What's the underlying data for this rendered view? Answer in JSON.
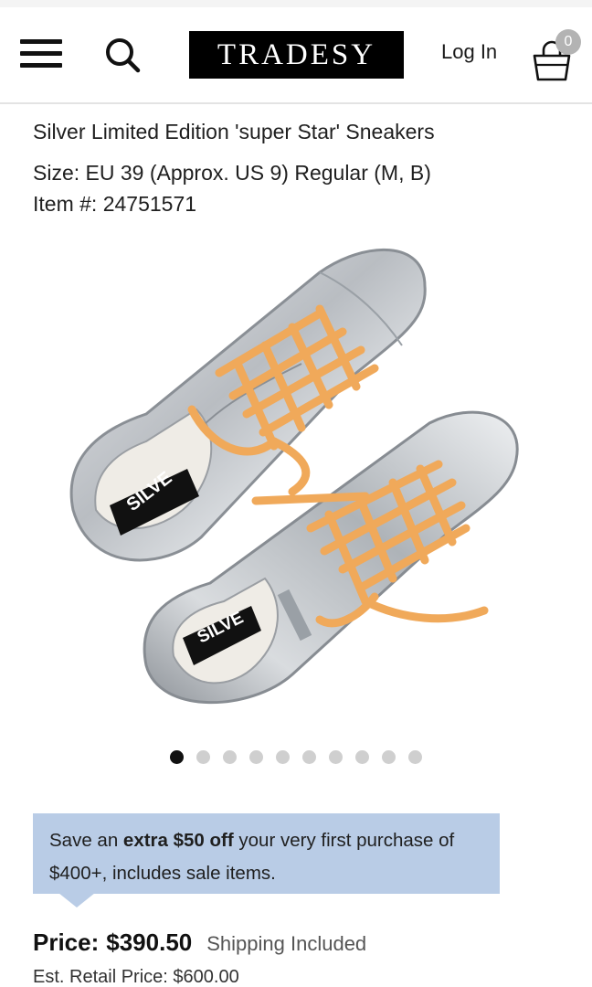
{
  "header": {
    "logo_text": "TRADESY",
    "login_label": "Log In",
    "cart_count": "0",
    "icons": {
      "menu": "hamburger-menu-icon",
      "search": "search-icon",
      "cart": "shopping-bag-icon"
    }
  },
  "product": {
    "title": "Silver Limited Edition 'super Star' Sneakers",
    "size_text": "Size: EU 39 (Approx. US 9) Regular (M, B)",
    "item_text": "Item #: 24751571",
    "label_text": "SILVE"
  },
  "gallery": {
    "total_images": 10,
    "active_index": 0
  },
  "promo": {
    "prefix": "Save an ",
    "highlight": "extra $50 off",
    "suffix": " your very first purchase of $400+, includes sale items."
  },
  "pricing": {
    "price_label": "Price:",
    "price_value": "$390.50",
    "shipping": "Shipping Included",
    "retail_label": "Est. Retail Price:",
    "retail_value": "$600.00"
  },
  "colors": {
    "promo_bg": "#b9cce6",
    "logo_bg": "#000000",
    "lace": "#f0a95a",
    "shoe_silver": "#c9ccd0"
  }
}
